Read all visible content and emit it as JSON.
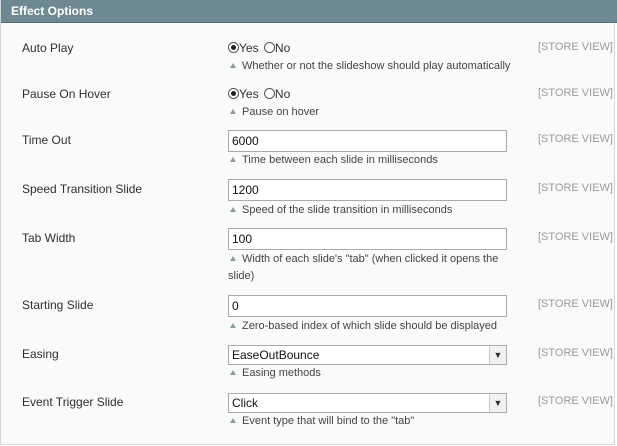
{
  "section": {
    "title": "Effect Options"
  },
  "scope_label": "[STORE VIEW]",
  "rows": {
    "auto_play": {
      "label": "Auto Play",
      "yes": "Yes",
      "no": "No",
      "selected": "Yes",
      "note": "Whether or not the slideshow should play automatically"
    },
    "pause_on_hover": {
      "label": "Pause On Hover",
      "yes": "Yes",
      "no": "No",
      "selected": "Yes",
      "note": "Pause on hover"
    },
    "time_out": {
      "label": "Time Out",
      "value": "6000",
      "note": "Time between each slide in milliseconds"
    },
    "speed_transition": {
      "label": "Speed Transition Slide",
      "value": "1200",
      "note": "Speed of the slide transition in milliseconds"
    },
    "tab_width": {
      "label": "Tab Width",
      "value": "100",
      "note": "Width of each slide's \"tab\" (when clicked it opens the slide)"
    },
    "starting_slide": {
      "label": "Starting Slide",
      "value": "0",
      "note": "Zero-based index of which slide should be displayed"
    },
    "easing": {
      "label": "Easing",
      "value": "EaseOutBounce",
      "note": "Easing methods"
    },
    "event_trigger": {
      "label": "Event Trigger Slide",
      "value": "Click",
      "note": "Event type that will bind to the \"tab\""
    }
  }
}
